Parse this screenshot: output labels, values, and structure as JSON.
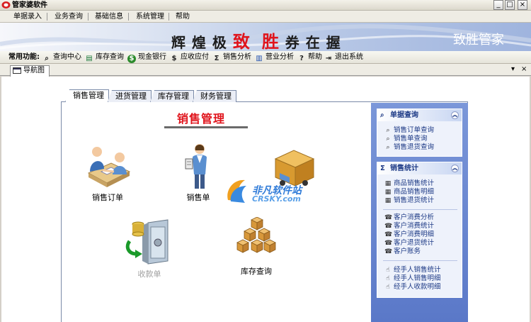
{
  "window": {
    "title": "管家婆软件",
    "controls": [
      "_",
      "□",
      "×"
    ]
  },
  "menu": [
    "单据录入",
    "业务查询",
    "基础信息",
    "系统管理",
    "帮助"
  ],
  "banner": {
    "slogan_pre": "辉 煌 极 ",
    "slogan_red1": "致",
    "slogan_mid": "  ",
    "slogan_red2": "胜",
    "slogan_post": " 券 在 握",
    "brand": "致胜管家"
  },
  "toolbar": {
    "label": "常用功能:",
    "items": [
      {
        "label": "查询中心",
        "icon": "binoculars-icon",
        "glyph": "⌕"
      },
      {
        "label": "库存查询",
        "icon": "storage-icon",
        "glyph": "▤"
      },
      {
        "label": "现金银行",
        "icon": "money-bag-icon",
        "glyph": "$"
      },
      {
        "label": "应收应付",
        "icon": "dollar-icon",
        "glyph": "$"
      },
      {
        "label": "销售分析",
        "icon": "sigma-icon",
        "glyph": "Σ"
      },
      {
        "label": "营业分析",
        "icon": "bar-chart-icon",
        "glyph": "▥"
      },
      {
        "label": "帮助",
        "icon": "help-icon",
        "glyph": "?"
      },
      {
        "label": "退出系统",
        "icon": "exit-icon",
        "glyph": "⇥"
      }
    ]
  },
  "doc_tab": {
    "label": "导航图",
    "controls": [
      "▾",
      "×"
    ]
  },
  "module_tabs": [
    "销售管理",
    "进货管理",
    "库存管理",
    "财务管理"
  ],
  "heading": "销售管理",
  "functions": [
    {
      "label": "销售订单",
      "enabled": true
    },
    {
      "label": "销售单",
      "enabled": true
    },
    {
      "label": "收款单",
      "enabled": false
    },
    {
      "label": "库存查询",
      "enabled": true
    }
  ],
  "watermark": {
    "line1": "非凡软件站",
    "line2": "CRSKY.com"
  },
  "side": {
    "query_box": {
      "title": "单据查询",
      "links": [
        "销售订单查询",
        "销售单查询",
        "销售退货查询"
      ]
    },
    "stats_box": {
      "title": "销售统计",
      "group1": [
        "商品销售统计",
        "商品销售明细",
        "销售退货统计"
      ],
      "group2": [
        "客户消费分析",
        "客户消费统计",
        "客户消费明细",
        "客户退货统计",
        "客户账务"
      ],
      "group3": [
        "经手人销售统计",
        "经手人销售明细",
        "经手人收款明细"
      ]
    }
  }
}
